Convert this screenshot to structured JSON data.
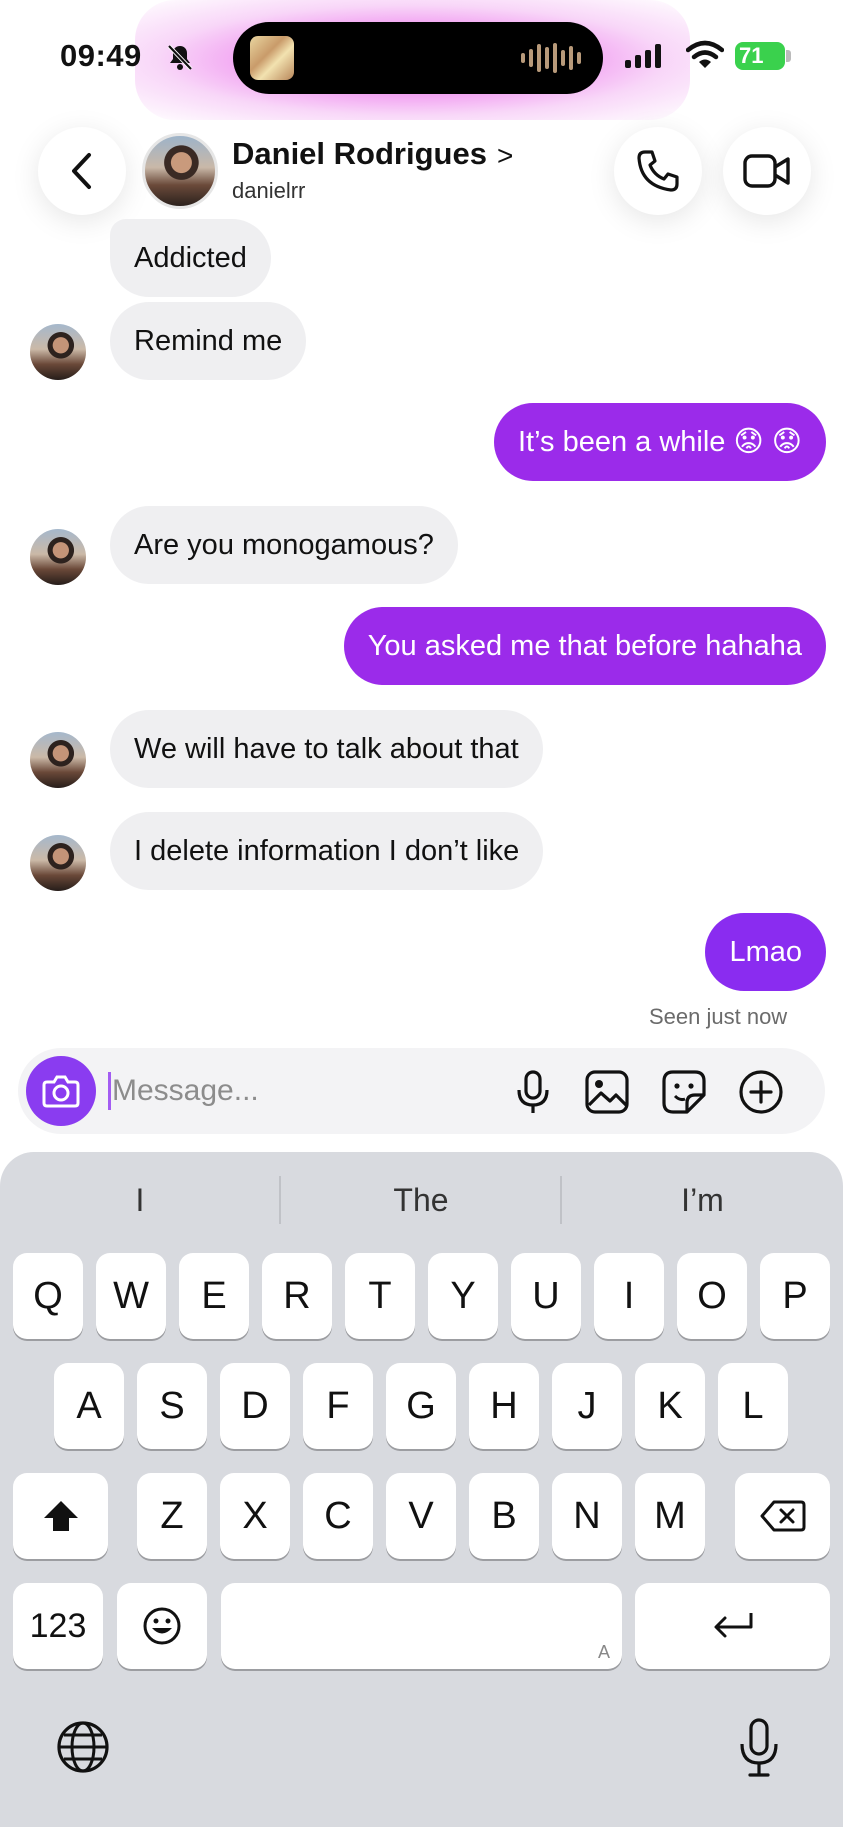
{
  "status_bar": {
    "time": "09:49",
    "battery": "71",
    "icons": [
      "bell-slash-icon",
      "signal-icon",
      "wifi-icon",
      "battery-icon"
    ]
  },
  "header": {
    "name": "Daniel Rodrigues",
    "chevron": ">",
    "username": "danielrr",
    "icons": [
      "back-icon",
      "phone-icon",
      "video-icon"
    ]
  },
  "messages": [
    {
      "side": "in",
      "text": "Addicted"
    },
    {
      "side": "in",
      "text": "Remind me"
    },
    {
      "side": "out",
      "text": "It’s been a while 😟 😟"
    },
    {
      "side": "in",
      "text": "Are you monogamous?"
    },
    {
      "side": "out",
      "text": "You asked me that before hahaha"
    },
    {
      "side": "in",
      "text": "We will have to talk about that"
    },
    {
      "side": "in",
      "text": "I delete information I don’t like"
    },
    {
      "side": "out",
      "text": "Lmao"
    }
  ],
  "seen": "Seen just now",
  "composer": {
    "placeholder": "Message...",
    "value": "",
    "icons": [
      "camera-icon",
      "microphone-icon",
      "gallery-icon",
      "sticker-icon",
      "add-icon"
    ]
  },
  "keyboard": {
    "suggestions": [
      "I",
      "The",
      "I’m"
    ],
    "row1": [
      "Q",
      "W",
      "E",
      "R",
      "T",
      "Y",
      "U",
      "I",
      "O",
      "P"
    ],
    "row2": [
      "A",
      "S",
      "D",
      "F",
      "G",
      "H",
      "J",
      "K",
      "L"
    ],
    "row3": [
      "Z",
      "X",
      "C",
      "V",
      "B",
      "N",
      "M"
    ],
    "numbers_label": "123",
    "space_hint": "A",
    "icons": [
      "shift-icon",
      "delete-icon",
      "emoji-icon",
      "return-icon",
      "globe-icon",
      "dictation-icon"
    ]
  },
  "colors": {
    "outgoing_bubble": "#9b2bea",
    "incoming_bubble": "#efeff1",
    "accent": "#8a3cf0",
    "status_glow": "#ec78ec",
    "battery": "#3ad14d"
  }
}
